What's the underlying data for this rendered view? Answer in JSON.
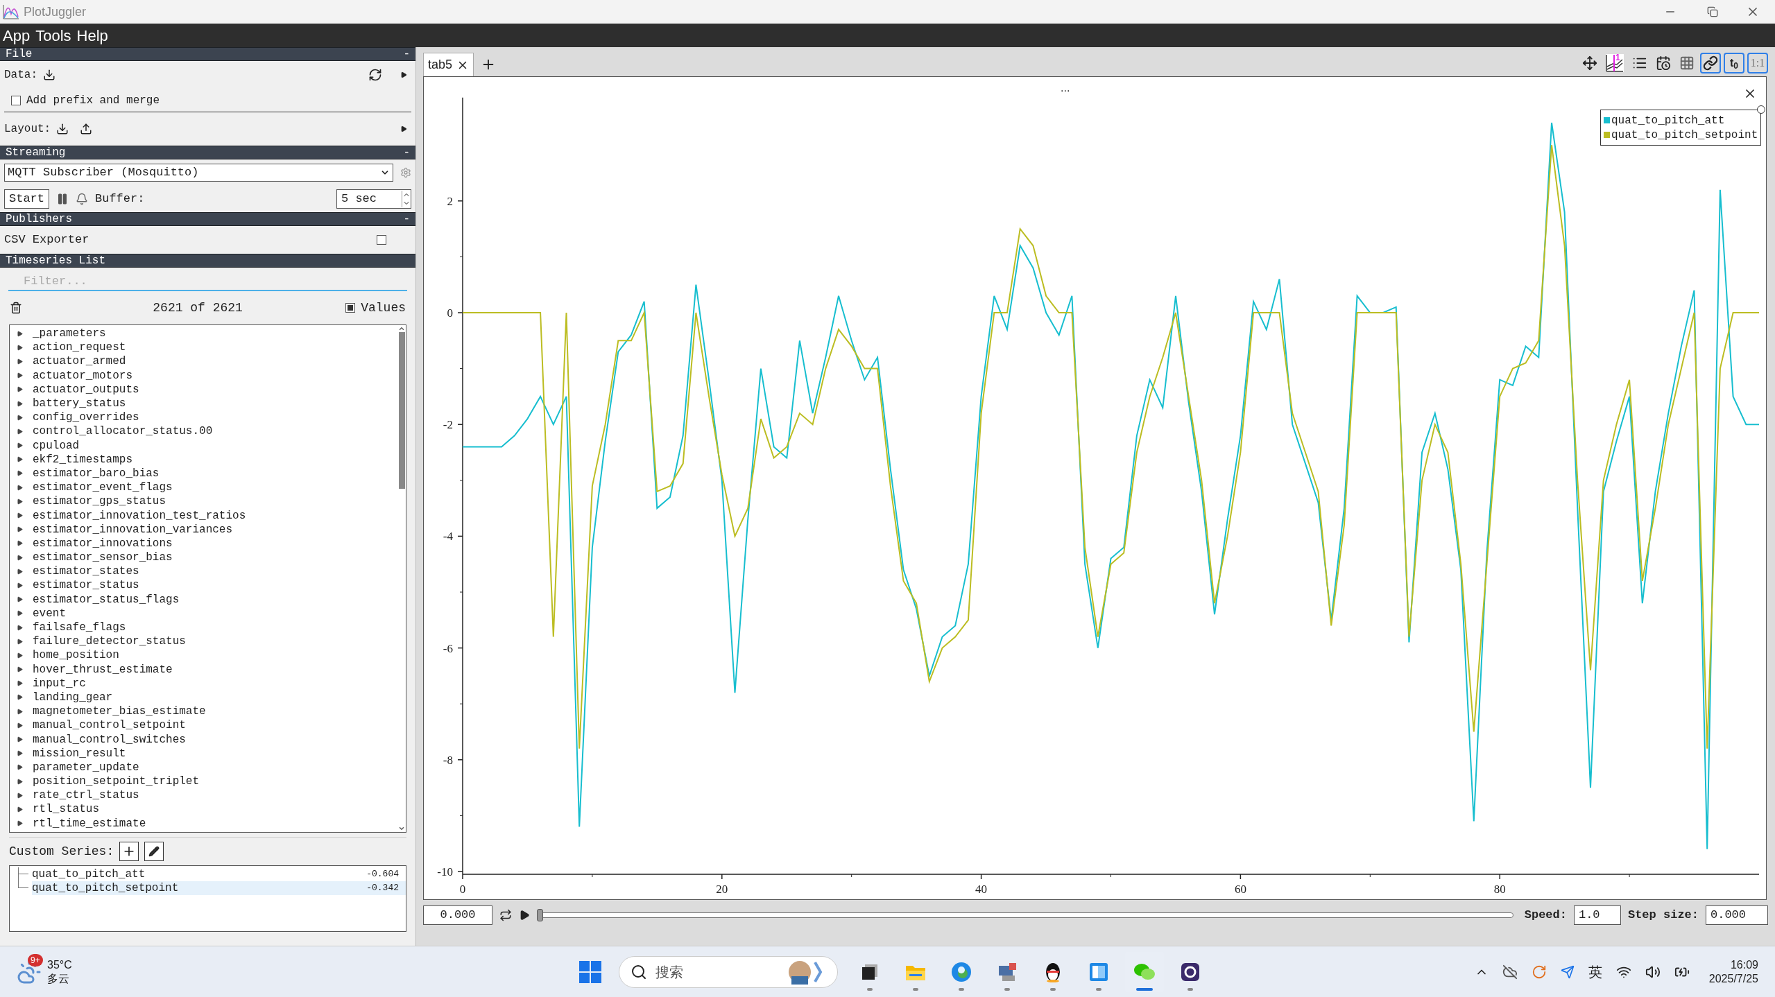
{
  "window": {
    "title": "PlotJuggler"
  },
  "menu": [
    "App",
    "Tools",
    "Help"
  ],
  "sidebar": {
    "file": {
      "header": "File",
      "collapse": "-",
      "data_label": "Data:",
      "prefix_checkbox": {
        "label": "Add prefix and merge",
        "checked": false
      },
      "layout_label": "Layout:"
    },
    "streaming": {
      "header": "Streaming",
      "collapse": "-",
      "source": "MQTT Subscriber (Mosquitto)",
      "start_button": "Start",
      "buffer_label": "Buffer:",
      "buffer_value": "5 sec"
    },
    "publishers": {
      "header": "Publishers",
      "collapse": "-",
      "items": [
        {
          "label": "CSV Exporter",
          "checked": false
        }
      ]
    },
    "timeseries": {
      "header": "Timeseries List",
      "filter_placeholder": "Filter...",
      "count": "2621 of 2621",
      "values_checkbox": {
        "label": "Values",
        "checked": true
      },
      "items": [
        "_parameters",
        "action_request",
        "actuator_armed",
        "actuator_motors",
        "actuator_outputs",
        "battery_status",
        "config_overrides",
        "control_allocator_status.00",
        "cpuload",
        "ekf2_timestamps",
        "estimator_baro_bias",
        "estimator_event_flags",
        "estimator_gps_status",
        "estimator_innovation_test_ratios",
        "estimator_innovation_variances",
        "estimator_innovations",
        "estimator_sensor_bias",
        "estimator_states",
        "estimator_status",
        "estimator_status_flags",
        "event",
        "failsafe_flags",
        "failure_detector_status",
        "home_position",
        "hover_thrust_estimate",
        "input_rc",
        "landing_gear",
        "magnetometer_bias_estimate",
        "manual_control_setpoint",
        "manual_control_switches",
        "mission_result",
        "parameter_update",
        "position_setpoint_triplet",
        "rate_ctrl_status",
        "rtl_status",
        "rtl_time_estimate"
      ]
    },
    "custom_series": {
      "label": "Custom Series:",
      "items": [
        {
          "name": "quat_to_pitch_att",
          "value": "-0.604",
          "selected": false
        },
        {
          "name": "quat_to_pitch_setpoint",
          "value": "-0.342",
          "selected": true
        }
      ]
    }
  },
  "tabs": [
    {
      "label": "tab5",
      "selected": true
    }
  ],
  "toolbar": [
    {
      "kind": "move",
      "active": false
    },
    {
      "kind": "tracker",
      "text": "1",
      "active": false
    },
    {
      "kind": "list",
      "active": false
    },
    {
      "kind": "calendar",
      "active": false
    },
    {
      "kind": "grid",
      "active": false
    },
    {
      "kind": "link",
      "active": true
    },
    {
      "kind": "text",
      "text": "t$_{0}$",
      "active": true
    },
    {
      "kind": "text",
      "text": "1:1",
      "active": true
    }
  ],
  "plot": {
    "menu": "...",
    "chart_data": {
      "type": "line",
      "x": [
        0,
        1,
        2,
        3,
        4,
        5,
        6,
        7,
        8,
        9,
        10,
        11,
        12,
        13,
        14,
        15,
        16,
        17,
        18,
        19,
        20,
        21,
        22,
        23,
        24,
        25,
        26,
        27,
        28,
        29,
        30,
        31,
        32,
        33,
        34,
        35,
        36,
        37,
        38,
        39,
        40,
        41,
        42,
        43,
        44,
        45,
        46,
        47,
        48,
        49,
        50,
        51,
        52,
        53,
        54,
        55,
        56,
        57,
        58,
        59,
        60,
        61,
        62,
        63,
        64,
        65,
        66,
        67,
        68,
        69,
        70,
        71,
        72,
        73,
        74,
        75,
        76,
        77,
        78,
        79,
        80,
        81,
        82,
        83,
        84,
        85,
        86,
        87,
        88,
        89,
        90,
        91,
        92,
        93,
        94,
        95,
        96,
        97,
        98,
        99,
        100
      ],
      "series": [
        {
          "name": "quat_to_pitch_att",
          "color": "#17becf",
          "values": [
            -2.4,
            -2.4,
            -2.4,
            -2.4,
            -2.2,
            -1.9,
            -1.5,
            -2,
            -1.5,
            -9.2,
            -4.2,
            -2.3,
            -0.7,
            -0.4,
            0.2,
            -3.5,
            -3.3,
            -2.2,
            0.5,
            -1.2,
            -3,
            -6.8,
            -3.7,
            -1,
            -2.4,
            -2.6,
            -0.5,
            -1.8,
            -0.8,
            0.3,
            -0.5,
            -1.2,
            -0.8,
            -2.8,
            -4.6,
            -5.3,
            -6.5,
            -5.8,
            -5.6,
            -4.5,
            -1.5,
            0.3,
            -0.3,
            1.2,
            0.8,
            0,
            -0.4,
            0.3,
            -4.5,
            -6,
            -4.4,
            -4.2,
            -2.2,
            -1.2,
            -1.7,
            0.3,
            -1.6,
            -3.2,
            -5.4,
            -3.7,
            -2.2,
            0.2,
            -0.3,
            0.6,
            -2,
            -2.7,
            -3.4,
            -5.5,
            -3.5,
            0.3,
            0,
            0,
            0.1,
            -5.9,
            -2.5,
            -1.8,
            -2.8,
            -4.6,
            -9.1,
            -4.3,
            -1.2,
            -1.3,
            -0.6,
            -0.8,
            3.4,
            1.8,
            -3.5,
            -8.5,
            -3.2,
            -2.3,
            -1.5,
            -5.2,
            -3.2,
            -1.8,
            -0.6,
            0.4,
            -9.6,
            2.2,
            -1.5,
            -2,
            -2
          ]
        },
        {
          "name": "quat_to_pitch_setpoint",
          "color": "#bcbd22",
          "values": [
            0,
            0,
            0,
            0,
            0,
            0,
            0,
            -5.8,
            0,
            -7.8,
            -3.1,
            -2,
            -0.5,
            -0.5,
            0,
            -3.2,
            -3.1,
            -2.7,
            0,
            -1.5,
            -2.9,
            -4,
            -3.5,
            -1.9,
            -2.6,
            -2.4,
            -1.8,
            -2,
            -1,
            -0.3,
            -0.6,
            -1,
            -1,
            -3.1,
            -4.8,
            -5.2,
            -6.6,
            -6,
            -5.8,
            -5.5,
            -1.8,
            0,
            0,
            1.5,
            1.2,
            0.3,
            0,
            0,
            -4.2,
            -5.8,
            -4.5,
            -4.3,
            -2.5,
            -1.5,
            -0.8,
            0,
            -1.5,
            -3,
            -5.2,
            -4,
            -2.5,
            0,
            0,
            0,
            -1.8,
            -2.5,
            -3.2,
            -5.6,
            -3.8,
            0,
            0,
            0,
            0,
            -5.8,
            -3,
            -2,
            -2.5,
            -4.5,
            -7.5,
            -4.5,
            -1.5,
            -1,
            -0.9,
            -0.5,
            3,
            1.2,
            -3,
            -6.4,
            -3,
            -2,
            -1.2,
            -4.8,
            -3.5,
            -2,
            -1,
            0,
            -7.8,
            -1,
            0,
            0,
            0
          ]
        }
      ],
      "xlim": [
        0,
        100
      ],
      "ylim": [
        -10,
        3.8
      ],
      "xticks": [
        0,
        20,
        40,
        60,
        80
      ],
      "yticks": [
        -10,
        -8,
        -6,
        -4,
        -2,
        0,
        2
      ]
    }
  },
  "player": {
    "time": "0.000",
    "level": 0,
    "speed_label": "Speed:",
    "speed": "1.0",
    "step_label": "Step size:",
    "step": "0.000"
  },
  "taskbar": {
    "weather": {
      "badge": "9+",
      "temperature": "35°C",
      "condition": "多云"
    },
    "search_placeholder": "搜索",
    "apps": [
      {
        "kind": "taskview",
        "selected": false
      },
      {
        "kind": "folder",
        "selected": false
      },
      {
        "kind": "browser",
        "selected": false
      },
      {
        "kind": "tool",
        "selected": false
      },
      {
        "kind": "penguin",
        "selected": false
      },
      {
        "kind": "window",
        "selected": false
      },
      {
        "kind": "chat",
        "selected": true
      },
      {
        "kind": "recorder",
        "selected": false
      }
    ],
    "language": "英",
    "time": "16:09",
    "date": "2025/7/25"
  }
}
